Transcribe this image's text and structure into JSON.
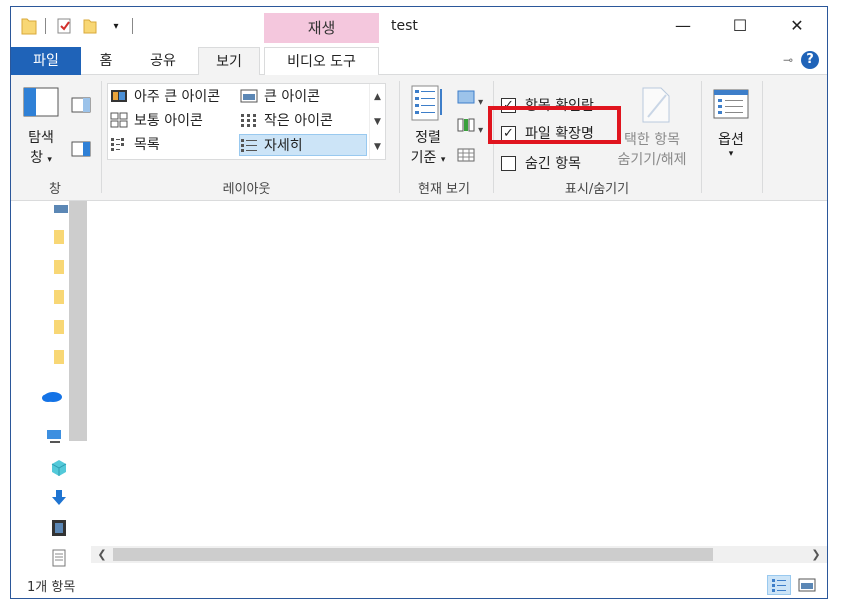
{
  "window": {
    "title": "test",
    "context_tab": "재생",
    "controls": {
      "minimize": "—",
      "maximize": "☐",
      "close": "✕"
    }
  },
  "tabs": [
    {
      "label": "파일"
    },
    {
      "label": "홈"
    },
    {
      "label": "공유"
    },
    {
      "label": "보기"
    },
    {
      "label": "비디오 도구"
    }
  ],
  "ribbon": {
    "pane_group": {
      "label": "창",
      "nav_pane_line1": "탐색",
      "nav_pane_line2": "창"
    },
    "layout_group": {
      "label": "레이아웃",
      "items": [
        {
          "label": "아주 큰 아이콘"
        },
        {
          "label": "큰 아이콘"
        },
        {
          "label": "보통 아이콘"
        },
        {
          "label": "작은 아이콘"
        },
        {
          "label": "목록"
        },
        {
          "label": "자세히"
        }
      ]
    },
    "current_view_group": {
      "label": "현재 보기",
      "sort_line1": "정렬",
      "sort_line2": "기준"
    },
    "show_hide_group": {
      "label": "표시/숨기기",
      "item_checkboxes": "항목 확인란",
      "file_extensions": "파일 확장명",
      "hidden_items": "숨긴 항목",
      "hide_selected_line1": "택한 항목",
      "hide_selected_line2": "숨기기/해제"
    },
    "options": {
      "label": "옵션"
    }
  },
  "status": {
    "item_count": "1개 항목"
  },
  "colors": {
    "accent": "#1f63b8",
    "context_tab": "#f4c7dd",
    "highlight": "#e0141e"
  }
}
